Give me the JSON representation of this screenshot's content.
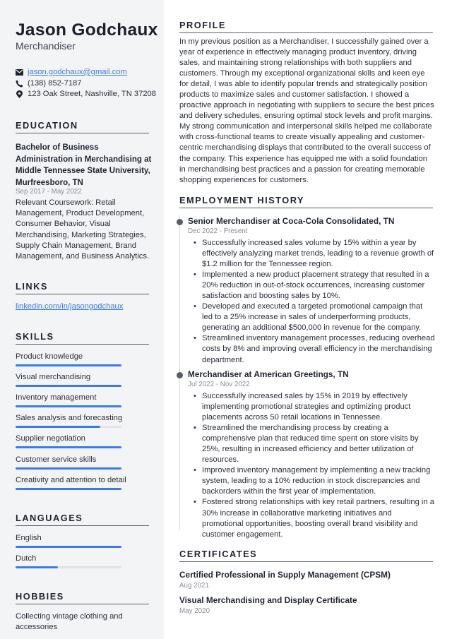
{
  "header": {
    "name": "Jason Godchaux",
    "title": "Merchandiser"
  },
  "contact": {
    "email": "jason.godchaux@gmail.com",
    "phone": "(138) 852-7187",
    "address": "123 Oak Street, Nashville, TN 37208",
    "icons": [
      "envelope-icon",
      "phone-icon",
      "map-pin-icon"
    ]
  },
  "education": {
    "heading": "EDUCATION",
    "degree": "Bachelor of Business Administration in Merchandising at Middle Tennessee State University, Murfreesboro, TN",
    "dates": "Sep 2017 - May 2022",
    "description": "Relevant Coursework: Retail Management, Product Development, Consumer Behavior, Visual Merchandising, Marketing Strategies, Supply Chain Management, Brand Management, and Business Analytics."
  },
  "links": {
    "heading": "LINKS",
    "items": [
      {
        "label": "linkedin.com/in/jasongodchaux"
      }
    ]
  },
  "skills": {
    "heading": "SKILLS",
    "items": [
      {
        "label": "Product knowledge",
        "level": 1.0
      },
      {
        "label": "Visual merchandising",
        "level": 1.0
      },
      {
        "label": "Inventory management",
        "level": 1.0
      },
      {
        "label": "Sales analysis and forecasting",
        "level": 0.8
      },
      {
        "label": "Supplier negotiation",
        "level": 1.0
      },
      {
        "label": "Customer service skills",
        "level": 1.0
      },
      {
        "label": "Creativity and attention to detail",
        "level": 1.0
      }
    ]
  },
  "languages": {
    "heading": "LANGUAGES",
    "items": [
      {
        "label": "English",
        "level": 1.0
      },
      {
        "label": "Dutch",
        "level": 0.4
      }
    ]
  },
  "hobbies": {
    "heading": "HOBBIES",
    "items": [
      "Collecting vintage clothing and accessories"
    ]
  },
  "profile": {
    "heading": "PROFILE",
    "text": "In my previous position as a Merchandiser, I successfully gained over a year of experience in effectively managing product inventory, driving sales, and maintaining strong relationships with both suppliers and customers. Through my exceptional organizational skills and keen eye for detail, I was able to identify popular trends and strategically position products to maximize sales and customer satisfaction. I showed a proactive approach in negotiating with suppliers to secure the best prices and delivery schedules, ensuring optimal stock levels and profit margins. My strong communication and interpersonal skills helped me collaborate with cross-functional teams to create visually appealing and customer-centric merchandising displays that contributed to the overall success of the company. This experience has equipped me with a solid foundation in merchandising best practices and a passion for creating memorable shopping experiences for customers."
  },
  "employment": {
    "heading": "EMPLOYMENT HISTORY",
    "jobs": [
      {
        "title": "Senior Merchandiser at Coca-Cola Consolidated, TN",
        "dates": "Dec 2022 - Present",
        "bullets": [
          "Successfully increased sales volume by 15% within a year by effectively analyzing market trends, leading to a revenue growth of $1.2 million for the Tennessee region.",
          "Implemented a new product placement strategy that resulted in a 20% reduction in out-of-stock occurrences, increasing customer satisfaction and boosting sales by 10%.",
          "Developed and executed a targeted promotional campaign that led to a 25% increase in sales of underperforming products, generating an additional $500,000 in revenue for the company.",
          "Streamlined inventory management processes, reducing overhead costs by 8% and improving overall efficiency in the merchandising department."
        ]
      },
      {
        "title": "Merchandiser at American Greetings, TN",
        "dates": "Jul 2022 - Nov 2022",
        "bullets": [
          "Successfully increased sales by 15% in 2019 by effectively implementing promotional strategies and optimizing product placements across 50 retail locations in Tennessee.",
          "Streamlined the merchandising process by creating a comprehensive plan that reduced time spent on store visits by 25%, resulting in increased efficiency and better utilization of resources.",
          "Improved inventory management by implementing a new tracking system, leading to a 10% reduction in stock discrepancies and backorders within the first year of implementation.",
          "Fostered strong relationships with key retail partners, resulting in a 30% increase in collaborative marketing initiatives and promotional opportunities, boosting overall brand visibility and customer engagement."
        ]
      }
    ]
  },
  "certificates": {
    "heading": "CERTIFICATES",
    "items": [
      {
        "name": "Certified Professional in Supply Management (CPSM)",
        "date": "Aug 2021"
      },
      {
        "name": "Visual Merchandising and Display Certificate",
        "date": "May 2020"
      }
    ]
  },
  "colors": {
    "accent": "#3b7be8",
    "sidebar_bg": "#f3f4f6",
    "text": "#1f2430",
    "muted": "#8a8e97"
  }
}
